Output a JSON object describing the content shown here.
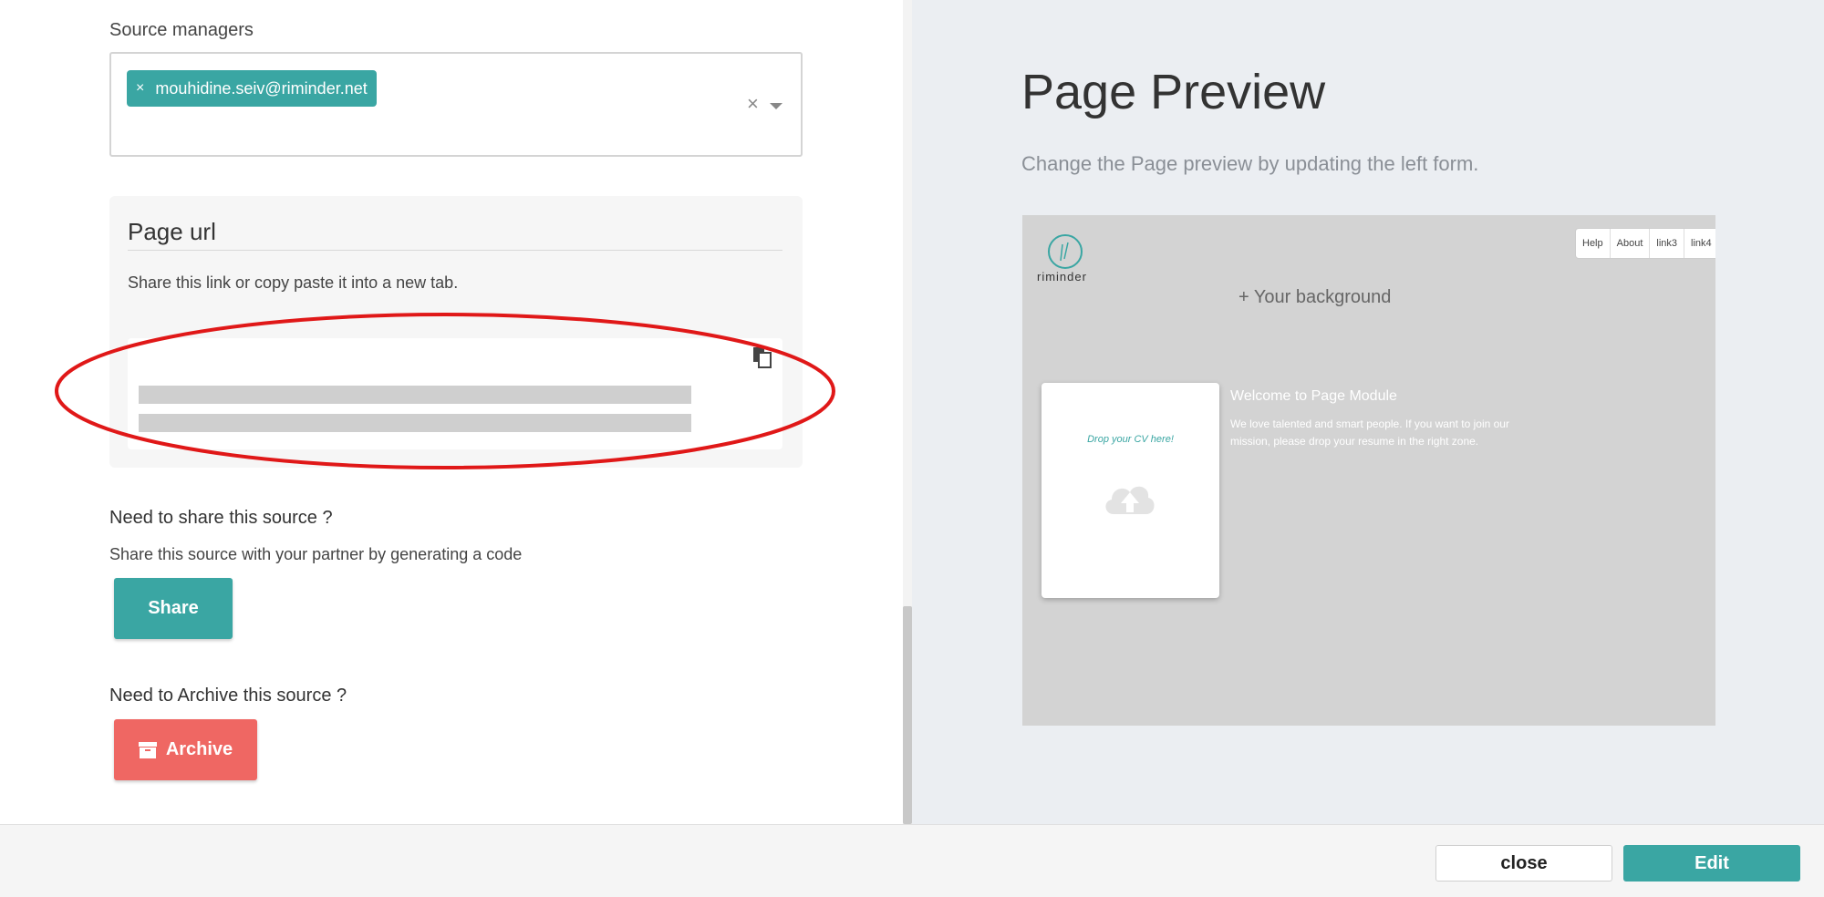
{
  "source_managers": {
    "label": "Source managers",
    "chips": [
      {
        "remove": "×",
        "text": "mouhidine.seiv@riminder.net"
      }
    ],
    "clear": "×",
    "accent": "#3aa6a3"
  },
  "page_url": {
    "title": "Page url",
    "description": "Share this link or copy paste it into a new tab.",
    "copy_icon": "copy-icon"
  },
  "share": {
    "title": "Need to share this source ?",
    "description": "Share this source with your partner by generating a code",
    "button": "Share"
  },
  "archive": {
    "title": "Need to Archive this source ?",
    "button": "Archive",
    "icon": "archive-box-icon",
    "color": "#ef6763"
  },
  "preview": {
    "title": "Page Preview",
    "subtitle": "Change the Page preview by updating the left form.",
    "logo_text": "riminder",
    "nav": [
      "Help",
      "About",
      "link3",
      "link4"
    ],
    "background_label": "+ Your background",
    "drop_text": "Drop your CV here!",
    "welcome_title": "Welcome to Page Module",
    "welcome_text": "We love talented and smart people. If you want to join our mission, please drop your resume in the right zone."
  },
  "footer": {
    "close": "close",
    "edit": "Edit"
  }
}
